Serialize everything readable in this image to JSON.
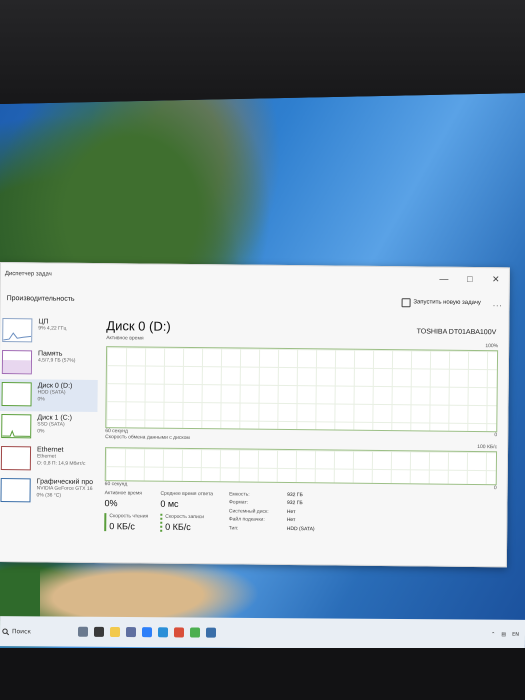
{
  "window": {
    "title": "Диспетчер задач",
    "page_title": "Производительность",
    "run_task": "Запустить новую задачу",
    "more": "..."
  },
  "sidebar": {
    "items": [
      {
        "name": "ЦП",
        "sub1": "9% 4,22 ГГц",
        "sub2": ""
      },
      {
        "name": "Память",
        "sub1": "4,5/7,9 ГБ (57%)",
        "sub2": ""
      },
      {
        "name": "Диск 0 (D:)",
        "sub1": "HDD (SATA)",
        "sub2": "0%"
      },
      {
        "name": "Диск 1 (C:)",
        "sub1": "SSD (SATA)",
        "sub2": "0%"
      },
      {
        "name": "Ethernet",
        "sub1": "Ethernet",
        "sub2": "О: 0,8 П: 14,9 Мбит/с"
      },
      {
        "name": "Графический про",
        "sub1": "NVIDIA GeForce GTX 16",
        "sub2": "0% (36 °C)"
      }
    ]
  },
  "detail": {
    "title": "Диск 0 (D:)",
    "model": "TOSHIBA DT01ABA100V",
    "active_time_label": "Активное время",
    "active_time_max": "100%",
    "sixty_sec_1": "60 секунд",
    "zero_1": "0",
    "transfer_label": "Скорость обмена данными с диском",
    "transfer_max": "100 КБ/с",
    "sixty_sec_2": "60 секунд",
    "zero_2": "0",
    "stats": {
      "active_time": {
        "label": "Активное время",
        "value": "0%"
      },
      "response": {
        "label": "Среднее время ответа",
        "value": "0 мс"
      },
      "read": {
        "label": "Скорость чтения",
        "value": "0 КБ/с"
      },
      "write": {
        "label": "Скорость записи",
        "value": "0 КБ/с"
      }
    },
    "props": [
      {
        "k": "Емкость:",
        "v": "932 ГБ"
      },
      {
        "k": "Формат:",
        "v": "932 ГБ"
      },
      {
        "k": "Системный диск:",
        "v": "Нет"
      },
      {
        "k": "Файл подкачки:",
        "v": "Нет"
      },
      {
        "k": "Тип:",
        "v": "HDD (SATA)"
      }
    ]
  },
  "taskbar": {
    "search": "Поиск",
    "lang": "EN"
  },
  "colors": {
    "disk_green": "#5a9e3b",
    "mem_purple": "#a06ab4",
    "cpu_blue": "#8da5c7",
    "eth_red": "#a04848"
  }
}
